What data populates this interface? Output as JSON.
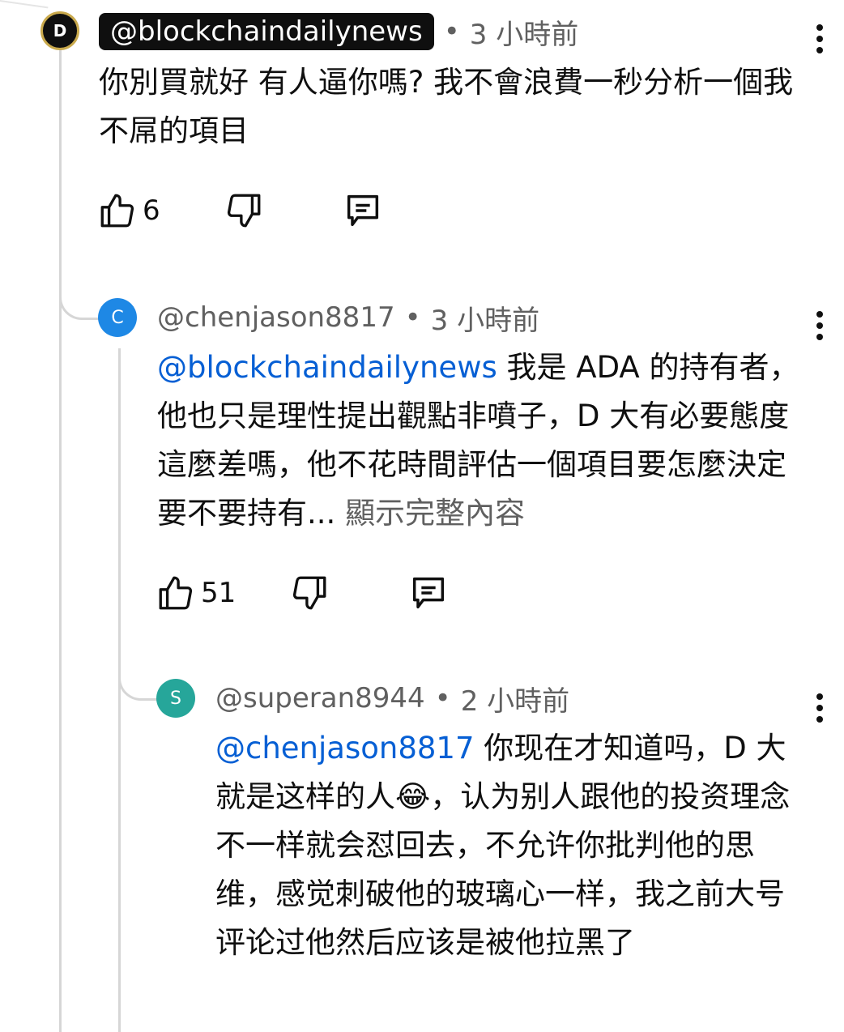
{
  "comments": [
    {
      "handle": "@blockchaindailynews",
      "time": "3 小時前",
      "text": "你別買就好 有人逼你嗎? 我不會浪費一秒分析一個我不屌的項目",
      "likes": "6",
      "avatar_letter": "D",
      "avatar_color": "#0f0f0f"
    },
    {
      "handle": "@chenjason8817",
      "time": "3 小時前",
      "mention": "@blockchaindailynews",
      "text": " 我是 ADA 的持有者，他也只是理性提出觀點非噴子，D 大有必要態度這麼差嗎，他不花時間評估一個項目要怎麼決定要不要持有...",
      "show_more": "顯示完整內容",
      "likes": "51",
      "avatar_letter": "C",
      "avatar_color": "#1e88e5"
    },
    {
      "handle": "@superan8944",
      "time": "2 小時前",
      "mention": "@chenjason8817",
      "text_before_emoji": " 你现在才知道吗，D 大就是这样的人",
      "emoji": "😂",
      "text_after_emoji": "，认为别人跟他的投资理念不一样就会怼回去，不允许你批判他的思维，感觉刺破他的玻璃心一样，我之前大号评论过他然后应该是被他拉黑了",
      "avatar_letter": "S",
      "avatar_color": "#26a69a"
    }
  ],
  "separator": "•"
}
